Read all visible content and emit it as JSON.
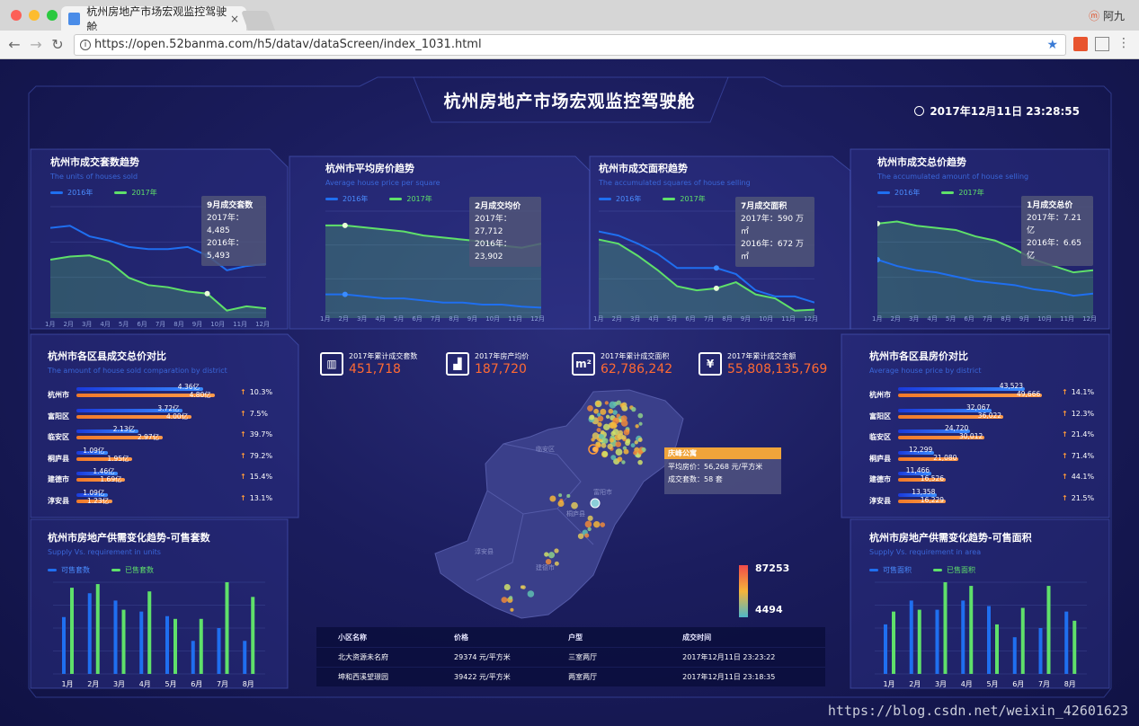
{
  "browser": {
    "tab_title": "杭州房地产市场宏观监控驾驶舱",
    "tab_close": "×",
    "user_name": "阿九",
    "url": "https://open.52banma.com/h5/datav/dataScreen/index_1031.html",
    "nav": {
      "back": "←",
      "forward": "→",
      "reload": "↻"
    },
    "star": "★",
    "menu": "⋮"
  },
  "dashboard": {
    "title": "杭州房地产市场宏观监控驾驶舱",
    "datetime": "2017年12月11日 23:28:55"
  },
  "months": [
    "1月",
    "2月",
    "3月",
    "4月",
    "5月",
    "6月",
    "7月",
    "8月",
    "9月",
    "10月",
    "11月",
    "12月"
  ],
  "legend_years": {
    "y2016": "2016年",
    "y2017": "2017年"
  },
  "panels": {
    "units_trend": {
      "title": "杭州市成交套数趋势",
      "subtitle": "The units of houses sold",
      "tooltip_title": "9月成交套数",
      "tooltip_2017": "2017年：4,485",
      "tooltip_2016": "2016年：5,493"
    },
    "price_trend": {
      "title": "杭州市平均房价趋势",
      "subtitle": "Average house price per square",
      "tooltip_title": "2月成交均价",
      "tooltip_2017": "2017年：27,712",
      "tooltip_2016": "2016年：23,902"
    },
    "area_trend": {
      "title": "杭州市成交面积趋势",
      "subtitle": "The accumulated squares of house selling",
      "tooltip_title": "7月成交面积",
      "tooltip_2017": "2017年：590 万㎡",
      "tooltip_2016": "2016年：672 万㎡"
    },
    "total_trend": {
      "title": "杭州市成交总价趋势",
      "subtitle": "The accumulated amount of house selling",
      "tooltip_title": "1月成交总价",
      "tooltip_2017": "2017年：7.21 亿",
      "tooltip_2016": "2016年：6.65 亿"
    },
    "district_total": {
      "title": "杭州市各区县成交总价对比",
      "subtitle": "The amount of house sold comparation by district",
      "rows": [
        {
          "name": "杭州市",
          "v2017": "4.36亿",
          "v2016": "4.80亿",
          "pct": "10.3%",
          "f1": 0.88,
          "f2": 0.96
        },
        {
          "name": "富阳区",
          "v2017": "3.72亿",
          "v2016": "4.00亿",
          "pct": "7.5%",
          "f1": 0.74,
          "f2": 0.8
        },
        {
          "name": "临安区",
          "v2017": "2.13亿",
          "v2016": "2.97亿",
          "pct": "39.7%",
          "f1": 0.43,
          "f2": 0.6
        },
        {
          "name": "桐庐县",
          "v2017": "1.09亿",
          "v2016": "1.95亿",
          "pct": "79.2%",
          "f1": 0.22,
          "f2": 0.39
        },
        {
          "name": "建德市",
          "v2017": "1.46亿",
          "v2016": "1.69亿",
          "pct": "15.4%",
          "f1": 0.29,
          "f2": 0.34
        },
        {
          "name": "淳安县",
          "v2017": "1.09亿",
          "v2016": "1.23亿",
          "pct": "13.1%",
          "f1": 0.22,
          "f2": 0.25
        }
      ]
    },
    "district_price": {
      "title": "杭州市各区县房价对比",
      "subtitle": "Average house price by district",
      "rows": [
        {
          "name": "杭州市",
          "v2017": "43,523",
          "v2016": "49,666",
          "pct": "14.1%",
          "f1": 0.88,
          "f2": 1.0
        },
        {
          "name": "富阳区",
          "v2017": "32,067",
          "v2016": "36,022",
          "pct": "12.3%",
          "f1": 0.65,
          "f2": 0.73
        },
        {
          "name": "临安区",
          "v2017": "24,720",
          "v2016": "30,012",
          "pct": "21.4%",
          "f1": 0.5,
          "f2": 0.6
        },
        {
          "name": "桐庐县",
          "v2017": "12,299",
          "v2016": "21,080",
          "pct": "71.4%",
          "f1": 0.25,
          "f2": 0.42
        },
        {
          "name": "建德市",
          "v2017": "11,466",
          "v2016": "16,526",
          "pct": "44.1%",
          "f1": 0.23,
          "f2": 0.33
        },
        {
          "name": "淳安县",
          "v2017": "13,358",
          "v2016": "16,229",
          "pct": "21.5%",
          "f1": 0.27,
          "f2": 0.33
        }
      ]
    },
    "supply_units": {
      "title": "杭州市房地产供需变化趋势-可售套数",
      "subtitle": "Supply Vs. requirement in units",
      "legend_a": "可售套数",
      "legend_b": "已售套数",
      "months": [
        "1月",
        "2月",
        "3月",
        "4月",
        "5月",
        "6月",
        "7月",
        "8月"
      ],
      "a": [
        0.62,
        0.88,
        0.8,
        0.68,
        0.63,
        0.36,
        0.5,
        0.36
      ],
      "b": [
        0.94,
        0.98,
        0.7,
        0.9,
        0.6,
        0.6,
        1.0,
        0.84
      ]
    },
    "supply_area": {
      "title": "杭州市房地产供需变化趋势-可售面积",
      "subtitle": "Supply Vs. requirement in area",
      "legend_a": "可售面积",
      "legend_b": "已售面积",
      "months": [
        "1月",
        "2月",
        "3月",
        "4月",
        "5月",
        "6月",
        "7月",
        "8月"
      ],
      "a": [
        0.54,
        0.8,
        0.7,
        0.8,
        0.74,
        0.4,
        0.5,
        0.68
      ],
      "b": [
        0.68,
        0.7,
        1.0,
        0.96,
        0.54,
        0.72,
        0.96,
        0.58
      ]
    }
  },
  "stats": [
    {
      "label": "2017年累计成交套数",
      "value": "451,718",
      "icon": "▥"
    },
    {
      "label": "2017年房产均价",
      "value": "187,720",
      "icon": "▟"
    },
    {
      "label": "2017年累计成交面积",
      "value": "62,786,242",
      "icon": "m²"
    },
    {
      "label": "2017年累计成交金额",
      "value": "55,808,135,769",
      "icon": "¥"
    }
  ],
  "map": {
    "districts": [
      "临安区",
      "富阳市",
      "桐庐县",
      "淳安县",
      "建德市"
    ],
    "popup_title": "庆峰公寓",
    "popup_price": "平均房价：56,268 元/平方米",
    "popup_units": "成交套数：58 套",
    "scale_high": "87253",
    "scale_low": "4494"
  },
  "table": {
    "headers": [
      "小区名称",
      "价格",
      "户型",
      "成交时间"
    ],
    "rows": [
      [
        "北大资源未名府",
        "29374 元/平方米",
        "三室两厅",
        "2017年12月11日 23:23:22"
      ],
      [
        "坤和西溪望璟园",
        "39422 元/平方米",
        "两室两厅",
        "2017年12月11日 23:18:35"
      ]
    ]
  },
  "watermark": "https://blog.csdn.net/weixin_42601623",
  "colors": {
    "s2016": "#1f6ff0",
    "s2017": "#5fe06a",
    "accent": "#ff6a33"
  }
}
